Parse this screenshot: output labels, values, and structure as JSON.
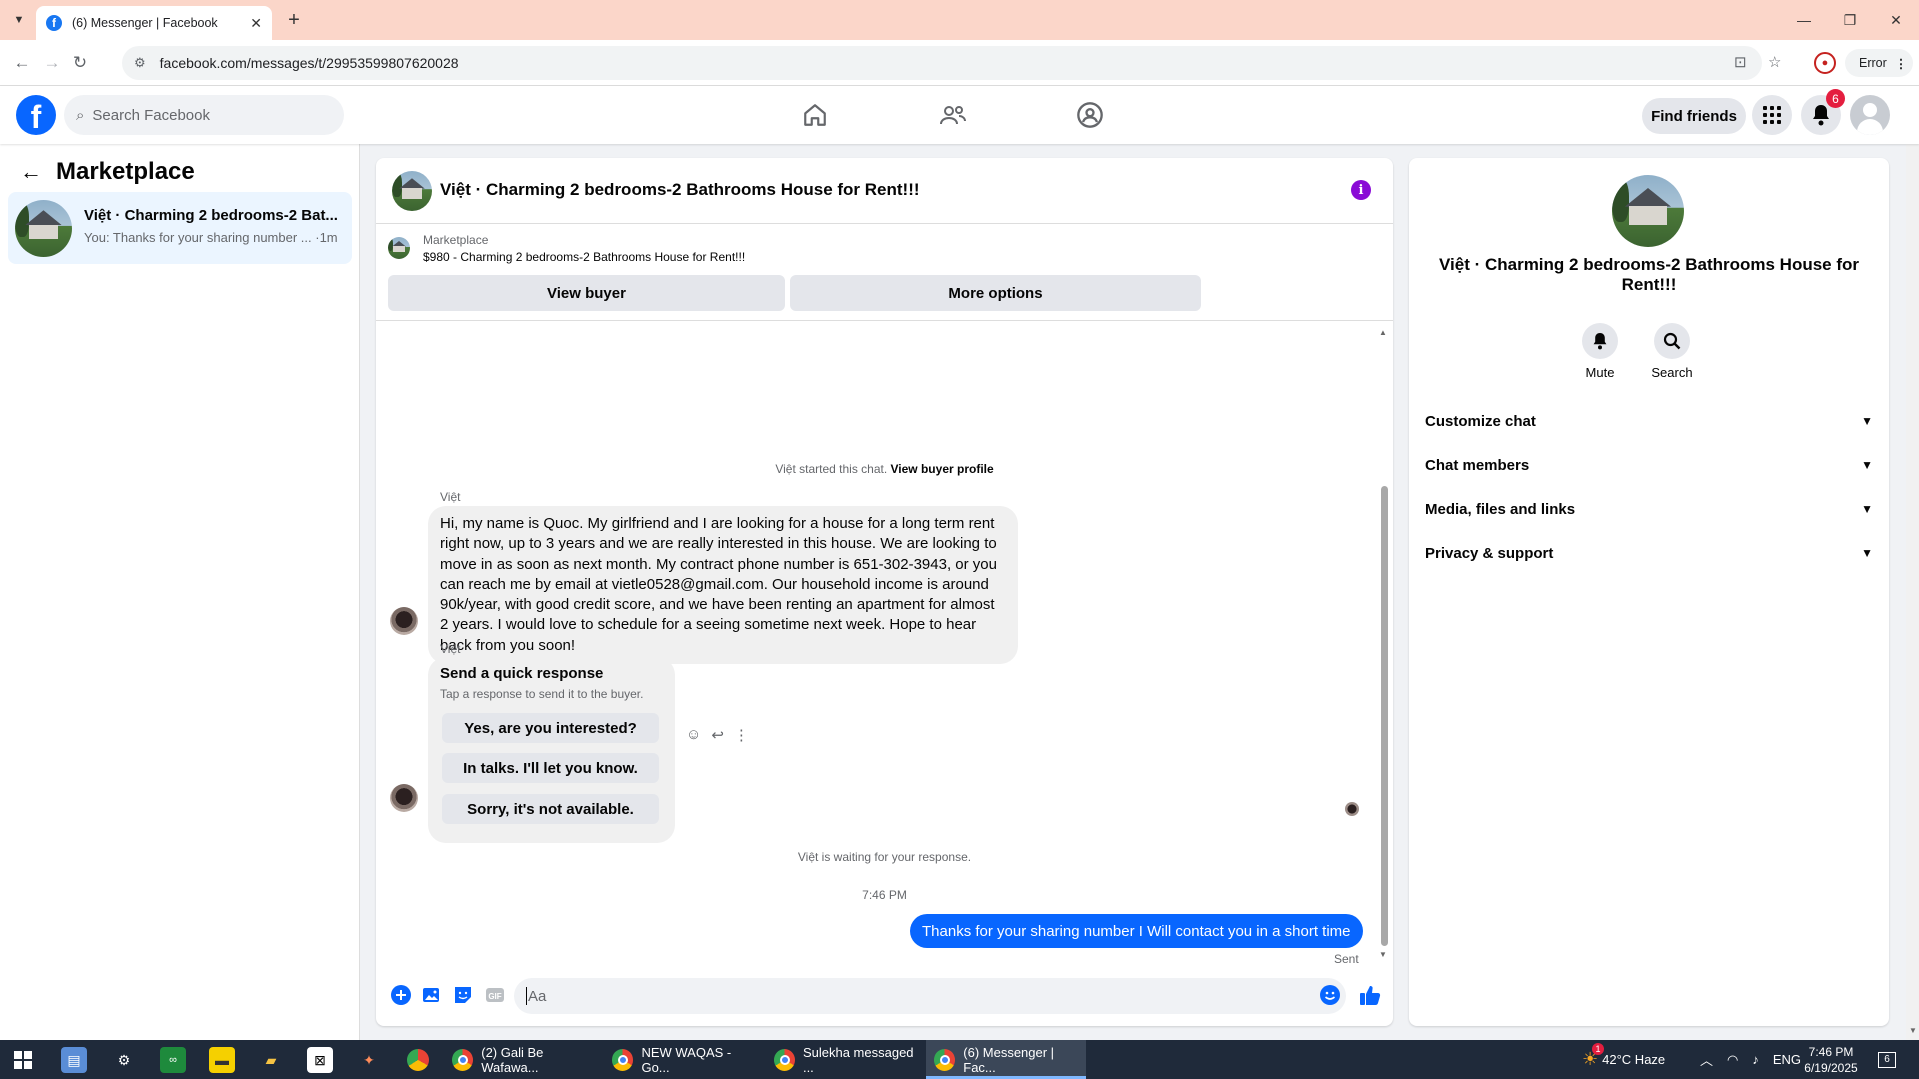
{
  "browser": {
    "tab_title": "(6) Messenger | Facebook",
    "url": "facebook.com/messages/t/29953599807620028",
    "error_label": "Error"
  },
  "header": {
    "search_placeholder": "Search Facebook",
    "find_friends": "Find friends",
    "notifications_count": "6"
  },
  "sidebar": {
    "title": "Marketplace",
    "conversation": {
      "name": "Việt · Charming 2 bedrooms-2 Bat...",
      "preview": "You: Thanks for your sharing number ... ·1m"
    }
  },
  "chat": {
    "title": "Việt · Charming 2 bedrooms-2 Bathrooms House for Rent!!!",
    "listing_label": "Marketplace",
    "listing_price": "$980 - Charming 2 bedrooms-2 Bathrooms House for Rent!!!",
    "view_buyer": "View buyer",
    "more_options": "More options",
    "started_prefix": "Việt started this chat.",
    "view_buyer_profile": "View buyer profile",
    "sender_name": "Việt",
    "message_1": "Hi, my name is Quoc. My girlfriend and I are looking for a house for a long term rent right now, up to 3 years and we are really interested in this house. We are looking to move in as soon as next month. My contract phone number is 651-302-3943, or you can reach me by email at vietle0528@gmail.com. Our household income is around 90k/year, with good credit score, and we have been renting an apartment for almost 2 years. I would love to schedule for a seeing sometime next week. Hope to hear back from you soon!",
    "quick_response": {
      "title": "Send a quick response",
      "subtitle": "Tap a response to send it to the buyer.",
      "options": [
        "Yes, are you interested?",
        "In talks. I'll let you know.",
        "Sorry, it's not available."
      ]
    },
    "waiting_note": "Việt is waiting for your response.",
    "timestamp": "7:46 PM",
    "outgoing_message": "Thanks for your sharing number I Will contact you in  a short time",
    "sent_status": "Sent",
    "composer_placeholder": "Aa"
  },
  "right_panel": {
    "title": "Việt · Charming 2 bedrooms-2 Bathrooms House for Rent!!!",
    "mute": "Mute",
    "search": "Search",
    "rows": [
      "Customize chat",
      "Chat members",
      "Media, files and links",
      "Privacy & support"
    ]
  },
  "taskbar": {
    "apps": [
      "(2) Gali Be Wafawa...",
      "NEW WAQAS - Go...",
      "Sulekha messaged ...",
      "(6) Messenger | Fac..."
    ],
    "weather": "42°C  Haze",
    "lang": "ENG",
    "time": "7:46 PM",
    "date": "6/19/2025",
    "notif_count": "6",
    "weather_badge": "1"
  },
  "colors": {
    "fb_blue": "#0866ff",
    "badge_red": "#e41e3f",
    "info_purple": "#8a0bd6",
    "tab_bar": "#fbd6c9"
  }
}
